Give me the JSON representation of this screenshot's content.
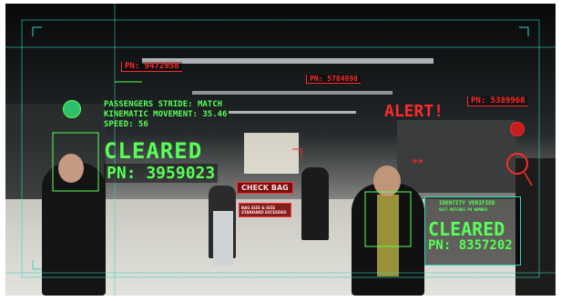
{
  "overlay": {
    "pn_tags": [
      {
        "id": "pn-9472958",
        "text": "PN: 9472958"
      },
      {
        "id": "pn-5784898",
        "text": "PN: 5784898"
      },
      {
        "id": "pn-5389968",
        "text": "PN: 5389968"
      }
    ],
    "alert": "ALERT!",
    "stride_lines": [
      "PASSENGERS STRIDE: MATCH",
      "KINEMATIC MOVEMENT: 35.46",
      "SPEED: 56"
    ],
    "left_status": {
      "label": "CLEARED",
      "pn": "PN: 3959023"
    },
    "right_status": {
      "line1": "IDENTITY VERIFIED",
      "line2": "GAIT MATCHES PN NUMBER",
      "label": "CLEARED",
      "pn": "PN: 8357202"
    },
    "check_bag": "CHECK BAG",
    "small_red": "BAG SIZE & SIZE STANDARD EXCEEDED",
    "colors": {
      "hud_green": "#57ff57",
      "hud_cyan": "#2fd9c0",
      "alert_red": "#ff2a2a"
    }
  }
}
